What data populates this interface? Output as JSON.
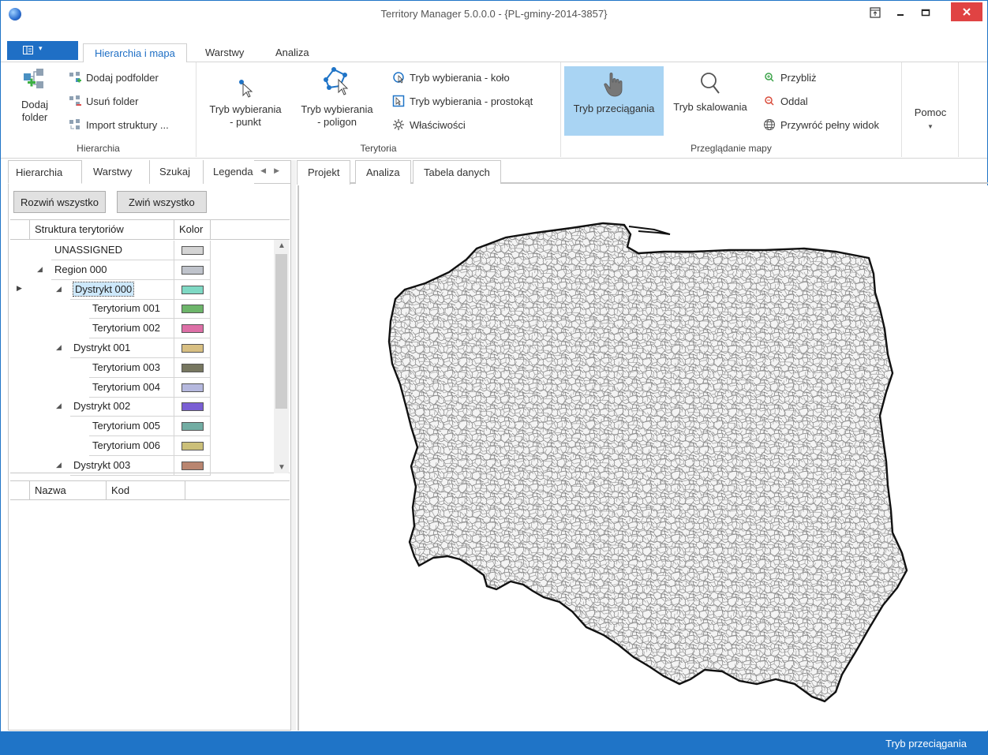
{
  "window": {
    "title": "Territory Manager 5.0.0.0 - {PL-gminy-2014-3857}"
  },
  "ribbon_tabs": {
    "file_menu_label": "",
    "tabs": [
      "Hierarchia i mapa",
      "Warstwy",
      "Analiza"
    ]
  },
  "ribbon": {
    "hierarchia": {
      "label": "Hierarchia",
      "add_folder": "Dodaj\nfolder",
      "add_folder_l1": "Dodaj",
      "add_folder_l2": "folder",
      "add_subfolder": "Dodaj podfolder",
      "remove_folder": "Usuń folder",
      "import_structure": "Import struktury ..."
    },
    "terytoria": {
      "label": "Terytoria",
      "select_point_l1": "Tryb wybierania",
      "select_point_l2": "- punkt",
      "select_polygon_l1": "Tryb wybierania",
      "select_polygon_l2": "- poligon",
      "select_circle": "Tryb wybierania - koło",
      "select_rect": "Tryb wybierania - prostokąt",
      "properties": "Właściwości"
    },
    "przegladanie": {
      "label": "Przeglądanie mapy",
      "drag_mode": "Tryb przeciągania",
      "scale_mode": "Tryb skalowania",
      "zoom_in": "Przybliż",
      "zoom_out": "Oddal",
      "full_view": "Przywróć pełny widok"
    },
    "help": {
      "label": "Pomoc"
    }
  },
  "left_panel": {
    "tabs": [
      "Hierarchia",
      "Warstwy",
      "Szukaj",
      "Legenda"
    ],
    "expand_all": "Rozwiń wszystko",
    "collapse_all": "Zwiń wszystko",
    "tree_headers": {
      "structure": "Struktura terytoriów",
      "color": "Kolor"
    },
    "tree_rows": [
      {
        "name": "UNASSIGNED",
        "level": 0,
        "expander": false,
        "color": "#d4d4d4"
      },
      {
        "name": "Region 000",
        "level": 0,
        "expander": true,
        "color": "#bfc3cb"
      },
      {
        "name": "Dystrykt 000",
        "level": 1,
        "expander": true,
        "color": "#7fd9c4",
        "selected": true
      },
      {
        "name": "Terytorium 001",
        "level": 2,
        "expander": false,
        "color": "#6db56a"
      },
      {
        "name": "Terytorium 002",
        "level": 2,
        "expander": false,
        "color": "#dd6fa6"
      },
      {
        "name": "Dystrykt 001",
        "level": 1,
        "expander": true,
        "color": "#d8bf82"
      },
      {
        "name": "Terytorium 003",
        "level": 2,
        "expander": false,
        "color": "#777760"
      },
      {
        "name": "Terytorium 004",
        "level": 2,
        "expander": false,
        "color": "#b5b8de"
      },
      {
        "name": "Dystrykt 002",
        "level": 1,
        "expander": true,
        "color": "#7a5fd4"
      },
      {
        "name": "Terytorium 005",
        "level": 2,
        "expander": false,
        "color": "#72ada3"
      },
      {
        "name": "Terytorium 006",
        "level": 2,
        "expander": false,
        "color": "#cbbf79"
      },
      {
        "name": "Dystrykt 003",
        "level": 1,
        "expander": true,
        "color": "#b98570"
      }
    ],
    "grid2_headers": {
      "name": "Nazwa",
      "code": "Kod"
    }
  },
  "doc_tabs": [
    "Projekt",
    "Analiza",
    "Tabela danych"
  ],
  "statusbar": {
    "mode": "Tryb przeciągania"
  }
}
